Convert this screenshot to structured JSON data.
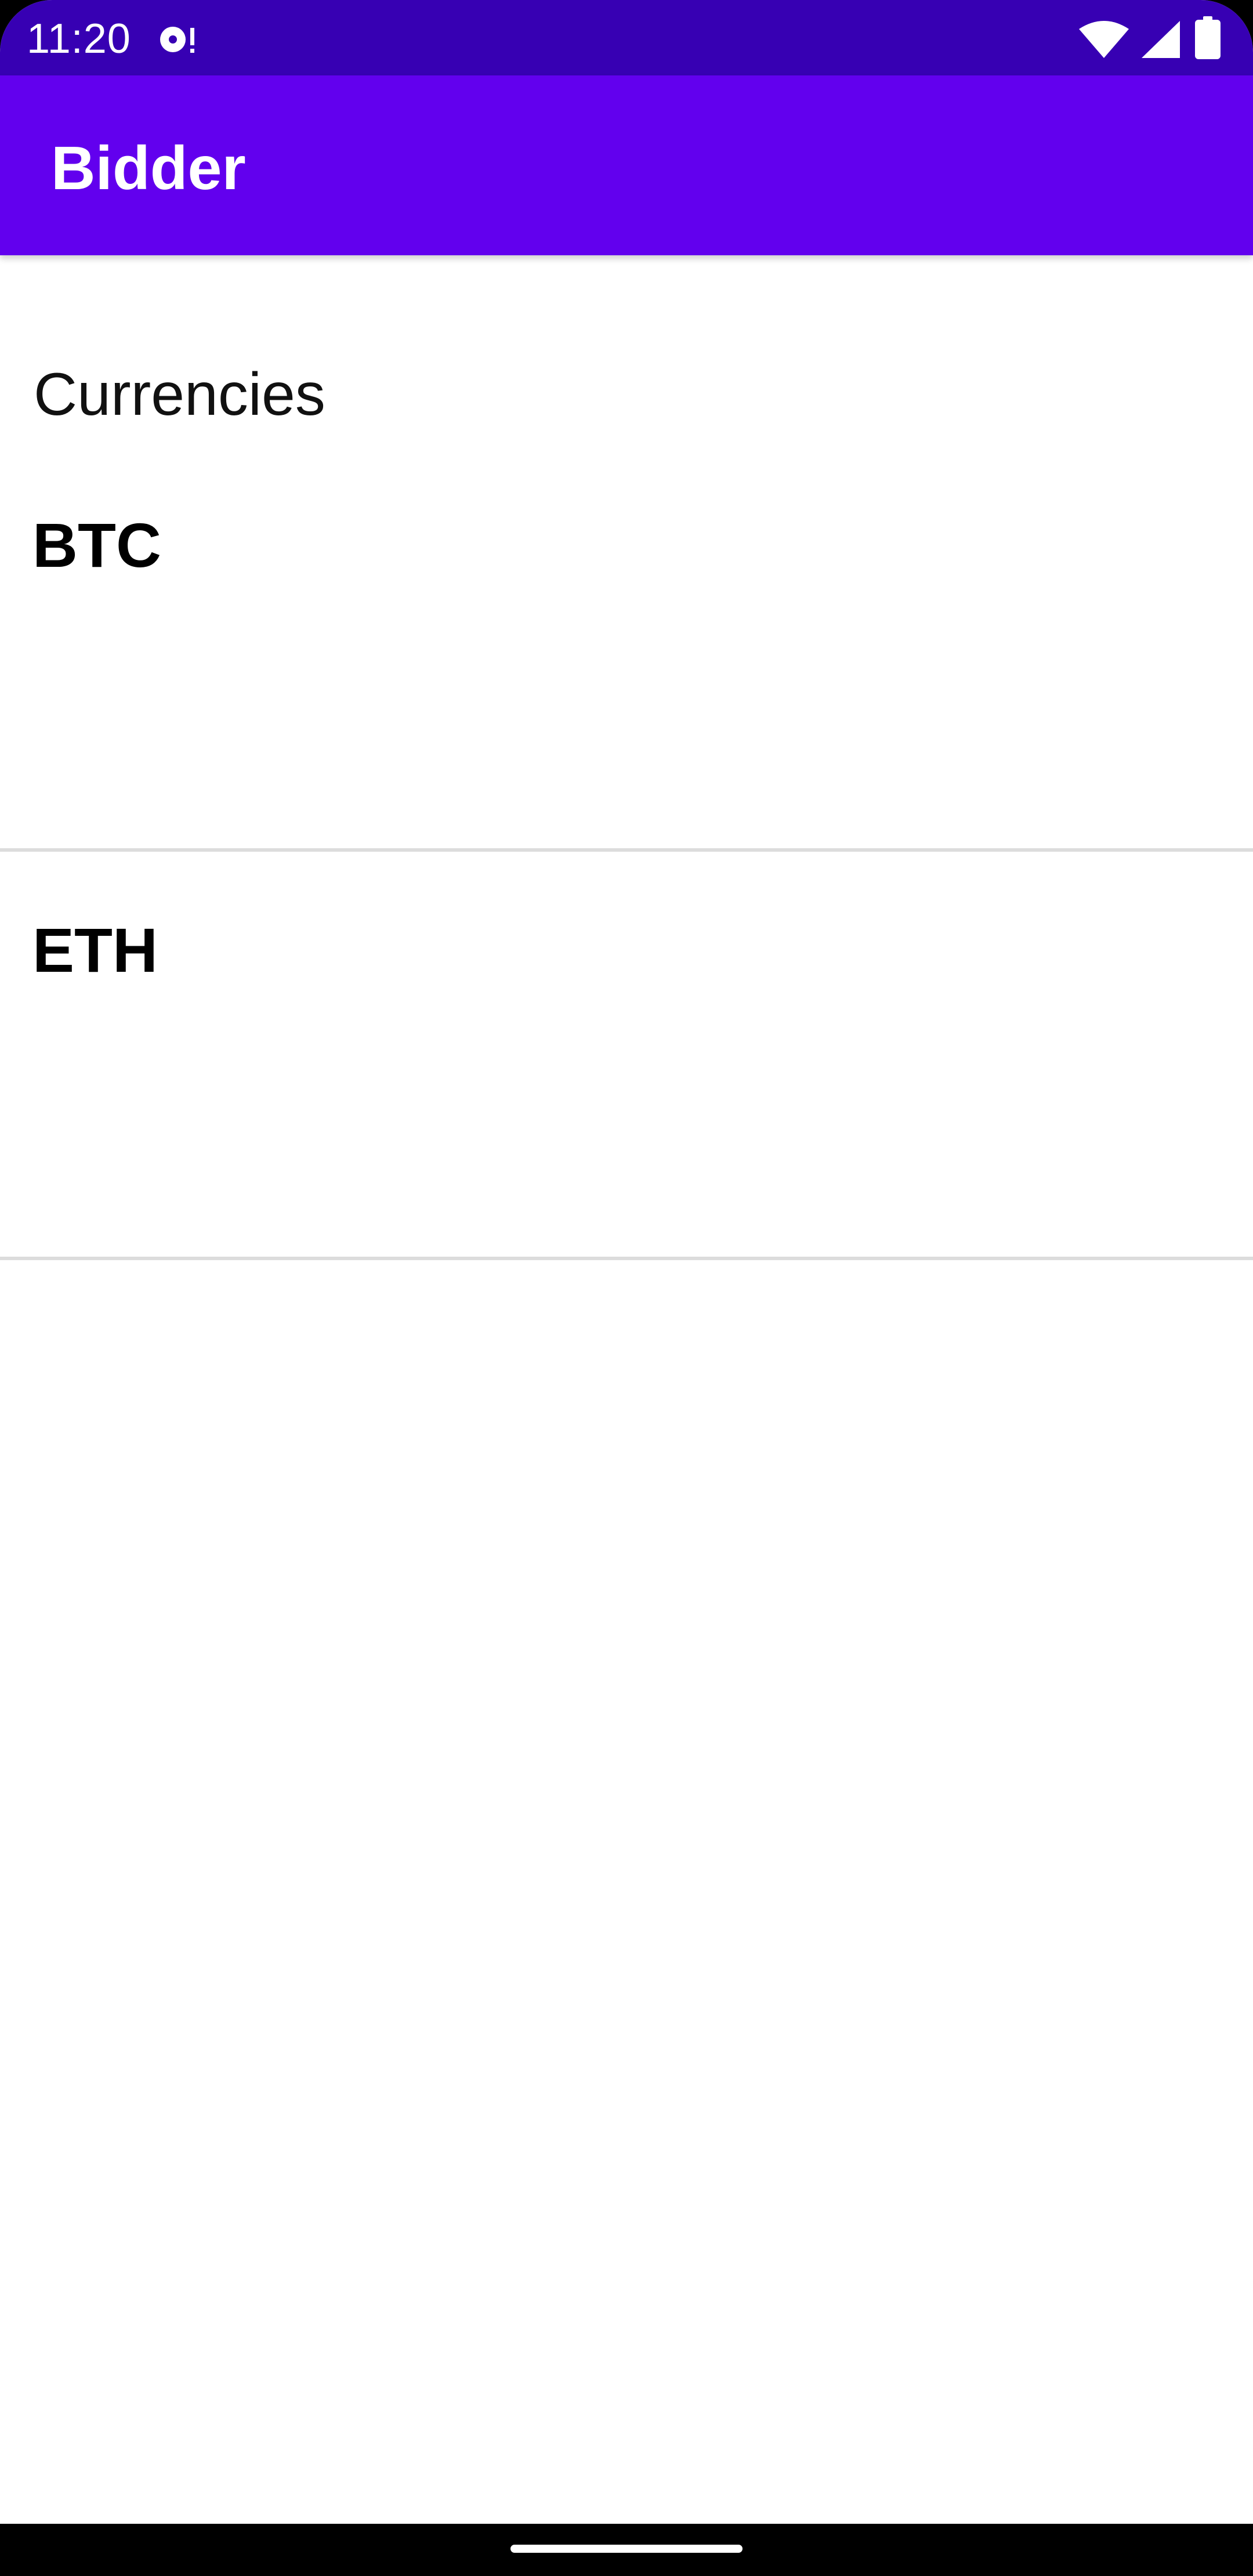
{
  "status_bar": {
    "time": "11:20",
    "icons": [
      "notification-icon",
      "wifi-icon",
      "signal-icon",
      "battery-icon"
    ],
    "background": "#3700b3"
  },
  "app_bar": {
    "title": "Bidder",
    "background": "#6200ee"
  },
  "main": {
    "section_title": "Currencies",
    "currencies": [
      {
        "symbol": "BTC"
      },
      {
        "symbol": "ETH"
      }
    ]
  },
  "nav_bar": {
    "gesture": "home-indicator"
  }
}
